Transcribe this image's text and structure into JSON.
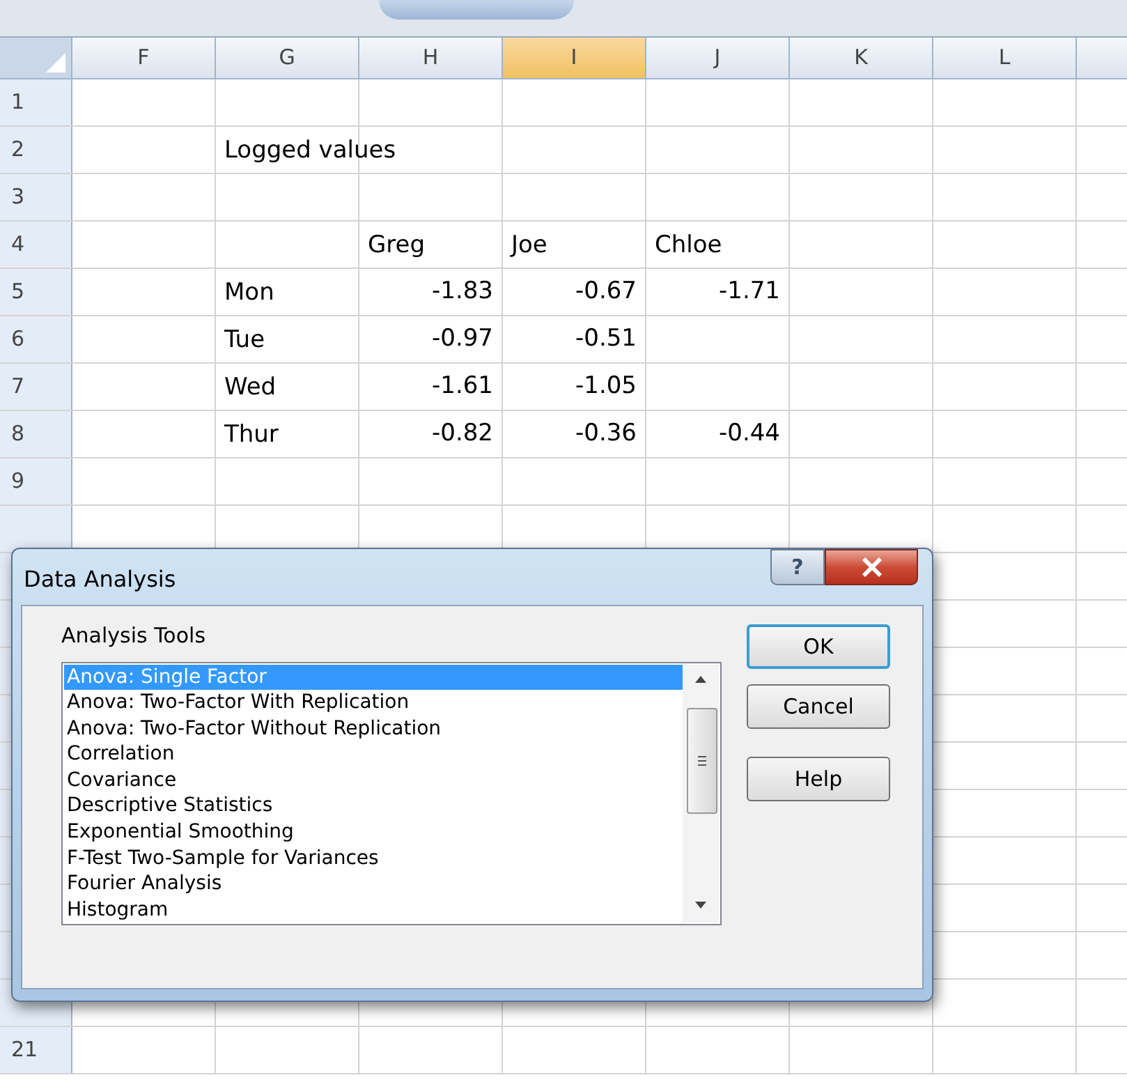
{
  "columns": [
    {
      "label": "F",
      "selected": false
    },
    {
      "label": "G",
      "selected": false
    },
    {
      "label": "H",
      "selected": false
    },
    {
      "label": "I",
      "selected": true
    },
    {
      "label": "J",
      "selected": false
    },
    {
      "label": "K",
      "selected": false
    },
    {
      "label": "L",
      "selected": false
    }
  ],
  "rows": [
    {
      "number": "1",
      "cells": {}
    },
    {
      "number": "2",
      "cells": {
        "g": {
          "text": "Logged values",
          "kind": "text"
        }
      }
    },
    {
      "number": "3",
      "cells": {}
    },
    {
      "number": "4",
      "cells": {
        "h": {
          "text": "Greg",
          "kind": "text"
        },
        "i": {
          "text": "Joe",
          "kind": "text"
        },
        "j": {
          "text": "Chloe",
          "kind": "text"
        }
      }
    },
    {
      "number": "5",
      "cells": {
        "g": {
          "text": "Mon",
          "kind": "text"
        },
        "h": {
          "text": "-1.83",
          "kind": "number"
        },
        "i": {
          "text": "-0.67",
          "kind": "number"
        },
        "j": {
          "text": "-1.71",
          "kind": "number"
        }
      }
    },
    {
      "number": "6",
      "cells": {
        "g": {
          "text": "Tue",
          "kind": "text"
        },
        "h": {
          "text": "-0.97",
          "kind": "number"
        },
        "i": {
          "text": "-0.51",
          "kind": "number"
        }
      }
    },
    {
      "number": "7",
      "cells": {
        "g": {
          "text": "Wed",
          "kind": "text"
        },
        "h": {
          "text": "-1.61",
          "kind": "number"
        },
        "i": {
          "text": "-1.05",
          "kind": "number"
        }
      }
    },
    {
      "number": "8",
      "cells": {
        "g": {
          "text": "Thur",
          "kind": "text"
        },
        "h": {
          "text": "-0.82",
          "kind": "number"
        },
        "i": {
          "text": "-0.36",
          "kind": "number"
        },
        "j": {
          "text": "-0.44",
          "kind": "number"
        }
      }
    },
    {
      "number": "9",
      "cells": {}
    },
    {
      "number": "21",
      "cells": {}
    }
  ],
  "dialog": {
    "title": "Data Analysis",
    "help_glyph": "?",
    "group_label": "Analysis Tools",
    "tools": [
      {
        "label": "Anova: Single Factor",
        "selected": true
      },
      {
        "label": "Anova: Two-Factor With Replication",
        "selected": false
      },
      {
        "label": "Anova: Two-Factor Without Replication",
        "selected": false
      },
      {
        "label": "Correlation",
        "selected": false
      },
      {
        "label": "Covariance",
        "selected": false
      },
      {
        "label": "Descriptive Statistics",
        "selected": false
      },
      {
        "label": "Exponential Smoothing",
        "selected": false
      },
      {
        "label": "F-Test Two-Sample for Variances",
        "selected": false
      },
      {
        "label": "Fourier Analysis",
        "selected": false
      },
      {
        "label": "Histogram",
        "selected": false
      }
    ],
    "buttons": [
      {
        "label": "OK",
        "default": true
      },
      {
        "label": "Cancel",
        "default": false
      },
      {
        "label": "Help",
        "default": false
      }
    ]
  }
}
